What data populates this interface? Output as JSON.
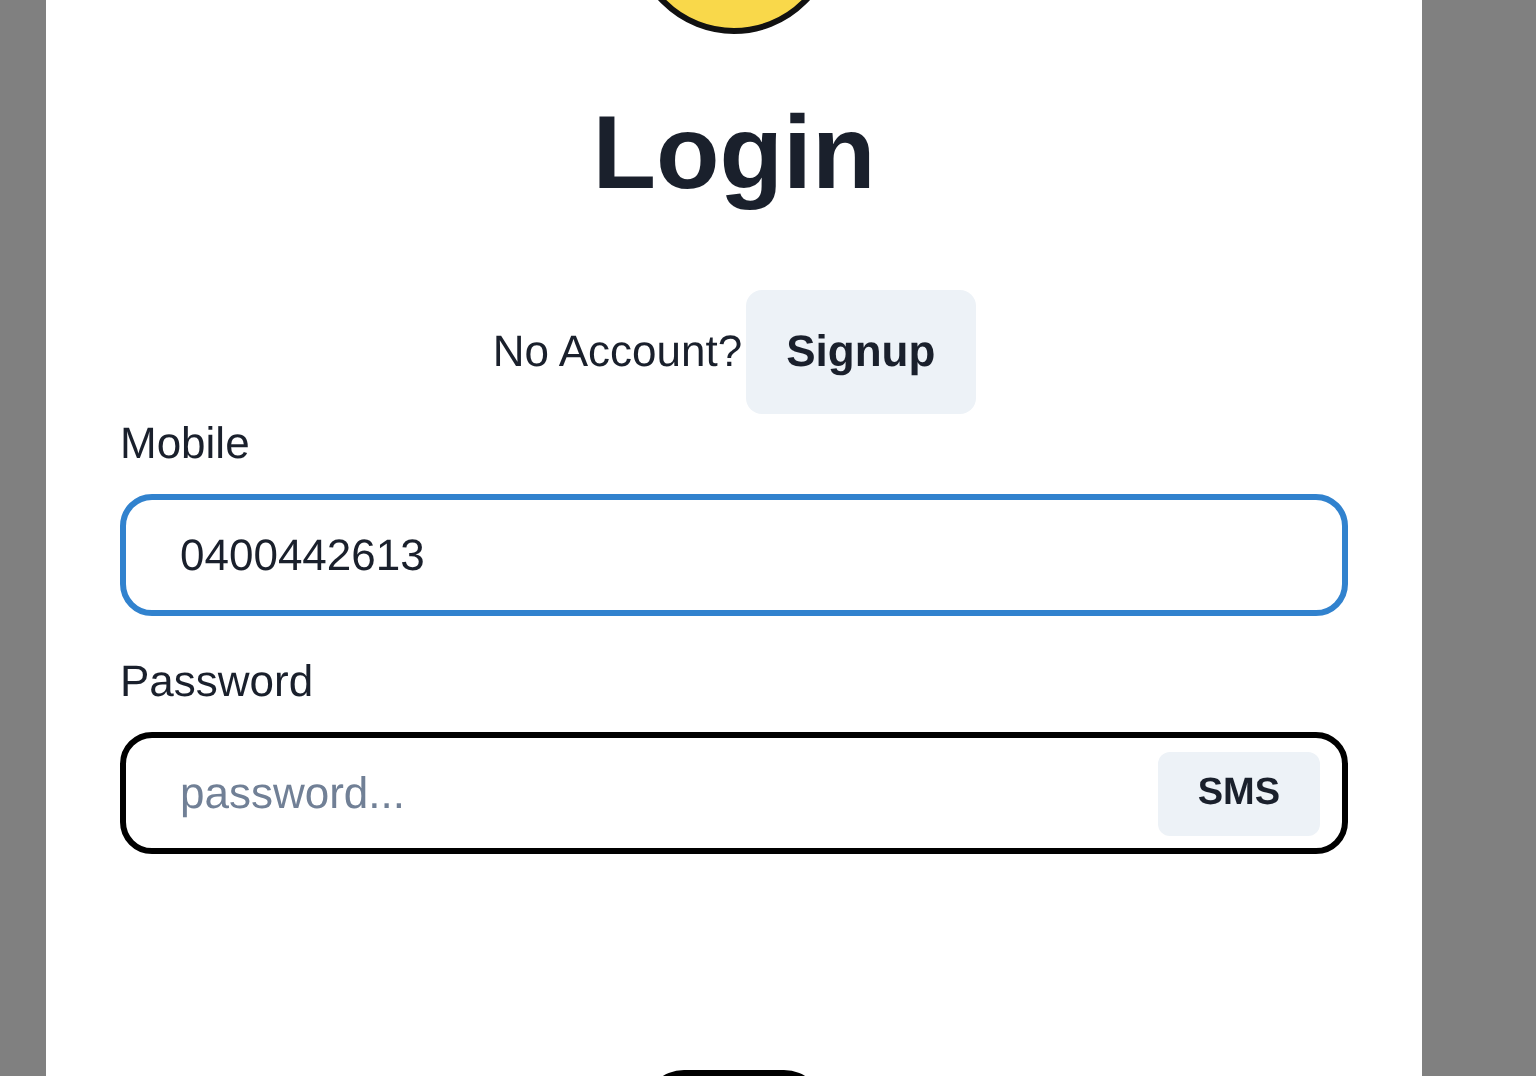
{
  "title": "Login",
  "signup_prompt": {
    "text": "No Account?",
    "button": "Signup"
  },
  "fields": [
    {
      "label": "Mobile",
      "value": "0400442613",
      "focused": true
    },
    {
      "label": "Password",
      "placeholder": "password...",
      "focused": false,
      "button": "SMS"
    }
  ]
}
